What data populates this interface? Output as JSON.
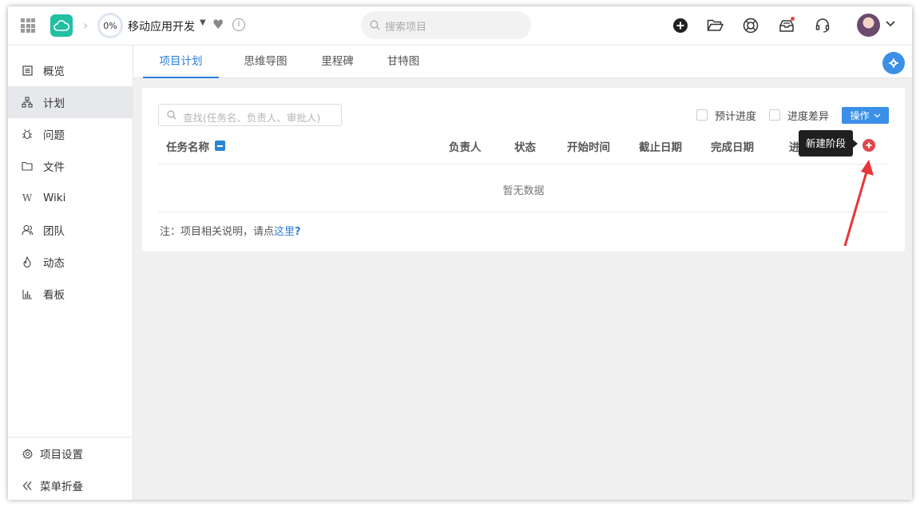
{
  "header": {
    "progress": "0%",
    "project_name": "移动应用开发",
    "search_placeholder": "搜索项目"
  },
  "sidebar": {
    "items": [
      {
        "label": "概览"
      },
      {
        "label": "计划"
      },
      {
        "label": "问题"
      },
      {
        "label": "文件"
      },
      {
        "label": "Wiki"
      },
      {
        "label": "团队"
      },
      {
        "label": "动态"
      },
      {
        "label": "看板"
      }
    ],
    "settings_label": "项目设置",
    "collapse_label": "菜单折叠"
  },
  "tabs": [
    {
      "label": "项目计划"
    },
    {
      "label": "思维导图"
    },
    {
      "label": "里程碑"
    },
    {
      "label": "甘特图"
    }
  ],
  "plan": {
    "search_placeholder": "查找(任务名、负责人、审批人)",
    "expected_progress_label": "预计进度",
    "progress_diff_label": "进度差异",
    "operate_label": "操作",
    "columns": [
      "任务名称",
      "负责人",
      "状态",
      "开始时间",
      "截止日期",
      "完成日期",
      "进"
    ],
    "empty_text": "暂无数据",
    "note_prefix": "注：项目相关说明，请点",
    "note_link": "这里",
    "note_suffix": "?",
    "tooltip": "新建阶段"
  },
  "colors": {
    "brand": "#22bfa3",
    "accent": "#3b8fe6",
    "add_button": "#e0464b",
    "annotation_arrow": "#e8353a"
  }
}
